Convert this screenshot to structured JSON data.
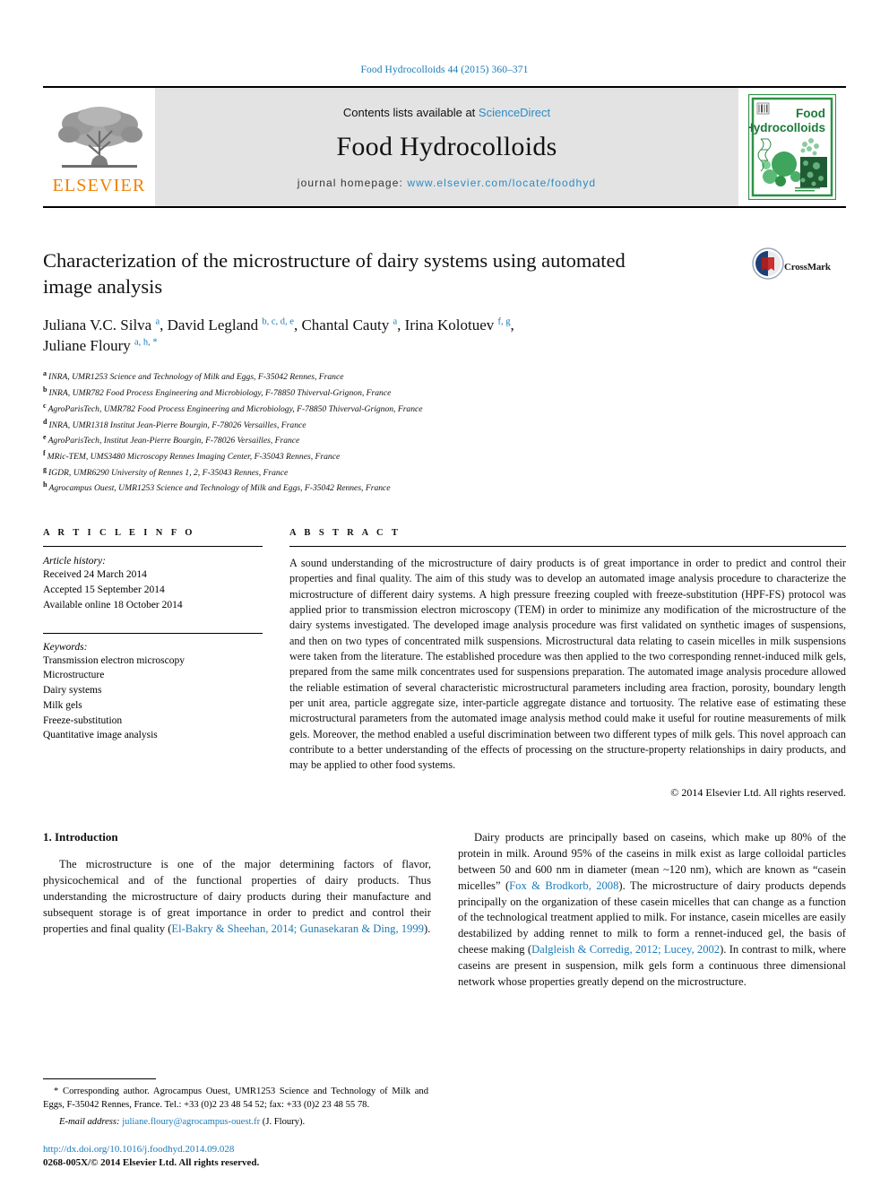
{
  "running_head": "Food Hydrocolloids 44 (2015) 360–371",
  "masthead": {
    "publisher_name": "ELSEVIER",
    "contents_prefix": "Contents lists available at",
    "sciencedirect": "ScienceDirect",
    "journal_title": "Food Hydrocolloids",
    "homepage_label": "journal homepage:",
    "homepage_url": "www.elsevier.com/locate/foodhyd",
    "cover_title_line1": "Food",
    "cover_title_line2": "Hydrocolloids"
  },
  "article": {
    "title": "Characterization of the microstructure of dairy systems using automated image analysis",
    "crossmark_label": "CrossMark",
    "authors": [
      {
        "name": "Juliana V.C. Silva",
        "marks": "a",
        "sep": ", "
      },
      {
        "name": "David Legland",
        "marks": "b, c, d, e",
        "sep": ", "
      },
      {
        "name": "Chantal Cauty",
        "marks": "a",
        "sep": ", "
      },
      {
        "name": "Irina Kolotuev",
        "marks": "f, g",
        "sep": ", "
      },
      {
        "name": "Juliane Floury",
        "marks": "a, h, *",
        "sep": ""
      }
    ],
    "affiliations": [
      {
        "mark": "a",
        "text": "INRA, UMR1253 Science and Technology of Milk and Eggs, F-35042 Rennes, France"
      },
      {
        "mark": "b",
        "text": "INRA, UMR782 Food Process Engineering and Microbiology, F-78850 Thiverval-Grignon, France"
      },
      {
        "mark": "c",
        "text": "AgroParisTech, UMR782 Food Process Engineering and Microbiology, F-78850 Thiverval-Grignon, France"
      },
      {
        "mark": "d",
        "text": "INRA, UMR1318 Institut Jean-Pierre Bourgin, F-78026 Versailles, France"
      },
      {
        "mark": "e",
        "text": "AgroParisTech, Institut Jean-Pierre Bourgin, F-78026 Versailles, France"
      },
      {
        "mark": "f",
        "text": "MRic-TEM, UMS3480 Microscopy Rennes Imaging Center, F-35043 Rennes, France"
      },
      {
        "mark": "g",
        "text": "IGDR, UMR6290 University of Rennes 1, 2, F-35043 Rennes, France"
      },
      {
        "mark": "h",
        "text": "Agrocampus Ouest, UMR1253 Science and Technology of Milk and Eggs, F-35042 Rennes, France"
      }
    ]
  },
  "article_info": {
    "heading": "A R T I C L E   I N F O",
    "history_label": "Article history:",
    "history": [
      "Received 24 March 2014",
      "Accepted 15 September 2014",
      "Available online 18 October 2014"
    ],
    "keywords_label": "Keywords:",
    "keywords": [
      "Transmission electron microscopy",
      "Microstructure",
      "Dairy systems",
      "Milk gels",
      "Freeze-substitution",
      "Quantitative image analysis"
    ]
  },
  "abstract": {
    "heading": "A B S T R A C T",
    "text": "A sound understanding of the microstructure of dairy products is of great importance in order to predict and control their properties and final quality. The aim of this study was to develop an automated image analysis procedure to characterize the microstructure of different dairy systems. A high pressure freezing coupled with freeze-substitution (HPF-FS) protocol was applied prior to transmission electron microscopy (TEM) in order to minimize any modification of the microstructure of the dairy systems investigated. The developed image analysis procedure was first validated on synthetic images of suspensions, and then on two types of concentrated milk suspensions. Microstructural data relating to casein micelles in milk suspensions were taken from the literature. The established procedure was then applied to the two corresponding rennet-induced milk gels, prepared from the same milk concentrates used for suspensions preparation. The automated image analysis procedure allowed the reliable estimation of several characteristic microstructural parameters including area fraction, porosity, boundary length per unit area, particle aggregate size, inter-particle aggregate distance and tortuosity. The relative ease of estimating these microstructural parameters from the automated image analysis method could make it useful for routine measurements of milk gels. Moreover, the method enabled a useful discrimination between two different types of milk gels. This novel approach can contribute to a better understanding of the effects of processing on the structure-property relationships in dairy products, and may be applied to other food systems.",
    "copyright": "© 2014 Elsevier Ltd. All rights reserved."
  },
  "body": {
    "section_number_title": "1. Introduction",
    "left_paragraph_pre": "The microstructure is one of the major determining factors of flavor, physicochemical and of the functional properties of dairy products. Thus understanding the microstructure of dairy products during their manufacture and subsequent storage is of great importance in order to predict and control their properties and final quality (",
    "left_paragraph_cite": "El-Bakry & Sheehan, 2014; Gunasekaran & Ding, 1999",
    "left_paragraph_post": ").",
    "right_seg_1": "Dairy products are principally based on caseins, which make up 80% of the protein in milk. Around 95% of the caseins in milk exist as large colloidal particles between 50 and 600 nm in diameter (mean ~120 nm), which are known as “casein micelles” (",
    "right_cite_1": "Fox & Brodkorb, 2008",
    "right_seg_2": "). The microstructure of dairy products depends principally on the organization of these casein micelles that can change as a function of the technological treatment applied to milk. For instance, casein micelles are easily destabilized by adding rennet to milk to form a rennet-induced gel, the basis of cheese making (",
    "right_cite_2": "Dalgleish & Corredig, 2012; Lucey, 2002",
    "right_seg_3": "). In contrast to milk, where caseins are present in suspension, milk gels form a continuous three dimensional network whose properties greatly depend on the microstructure."
  },
  "footnote": {
    "corresponding": "* Corresponding author. Agrocampus Ouest, UMR1253 Science and Technology of Milk and Eggs, F-35042 Rennes, France. Tel.: +33 (0)2 23 48 54 52; fax: +33 (0)2 23 48 55 78.",
    "email_label": "E-mail address:",
    "email": "juliane.floury@agrocampus-ouest.fr",
    "email_owner": "(J. Floury).",
    "doi": "http://dx.doi.org/10.1016/j.foodhyd.2014.09.028",
    "issn": "0268-005X/© 2014 Elsevier Ltd. All rights reserved."
  },
  "colors": {
    "link": "#1a7bb9",
    "sciencedirect": "#2b8cc4",
    "elsevier_orange": "#f08000",
    "masthead_bg": "#e3e3e3",
    "cover_green": "#2e9147"
  }
}
